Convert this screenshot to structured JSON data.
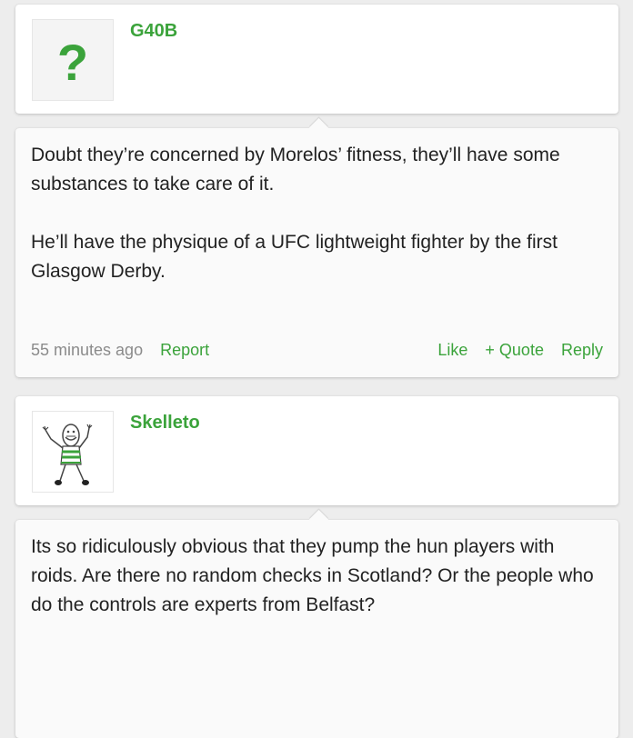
{
  "posts": [
    {
      "username": "G40B",
      "avatar": "question-mark-avatar",
      "paragraphs": [
        "Doubt they’re concerned by Morelos’ fitness, they’ll have some substances to take care of it.",
        "He’ll have the physique of a UFC lightweight fighter by the first Glasgow Derby."
      ],
      "timestamp": "55 minutes ago",
      "report_label": "Report",
      "like_label": "Like",
      "quote_label": "+ Quote",
      "reply_label": "Reply"
    },
    {
      "username": "Skelleto",
      "avatar": "stick-figure-avatar",
      "paragraphs": [
        "Its so ridiculously obvious that they pump the hun players with roids. Are there no random checks in Scotland? Or the people who do the controls are experts from Belfast?"
      ]
    }
  ],
  "colors": {
    "accent": "#3ba33b",
    "muted_text": "#8b8b8b",
    "body_text": "#222222",
    "page_bg": "#ededed"
  }
}
